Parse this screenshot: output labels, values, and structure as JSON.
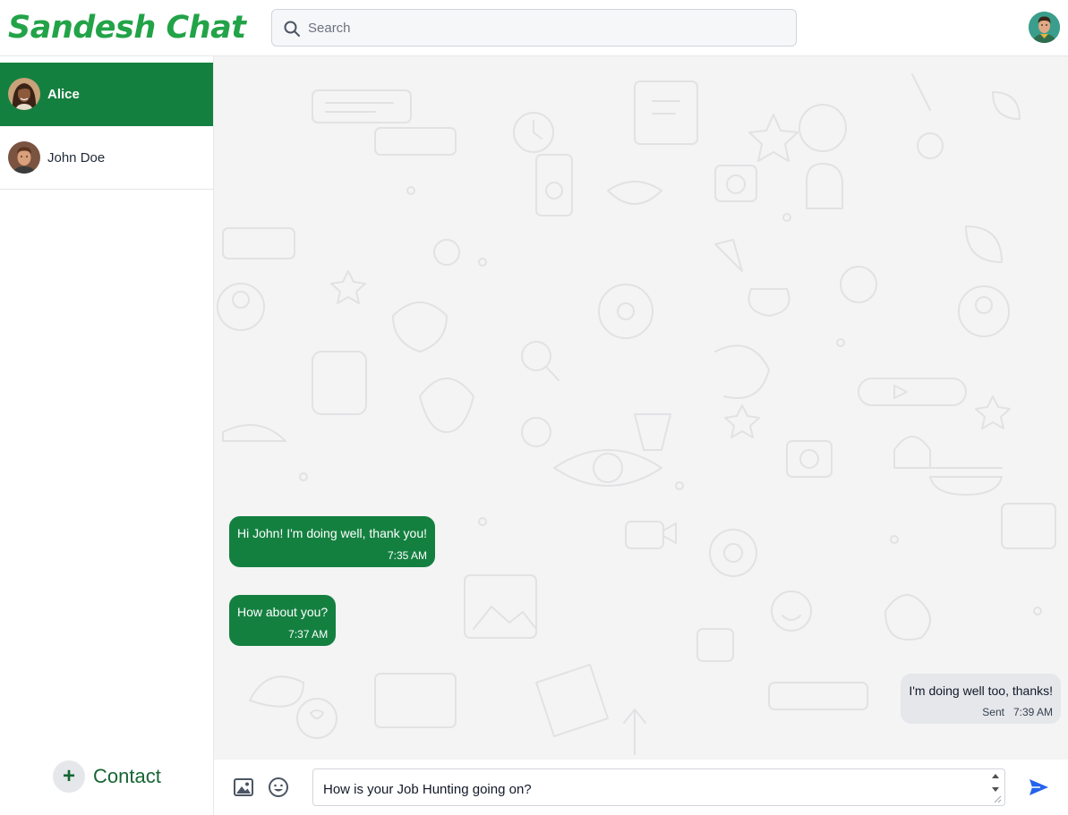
{
  "app": {
    "brand": "Sandesh Chat"
  },
  "search": {
    "placeholder": "Search",
    "icon": "search-icon"
  },
  "contacts": [
    {
      "name": "Alice",
      "active": true
    },
    {
      "name": "John Doe",
      "active": false
    }
  ],
  "sidebar": {
    "add_contact_icon": "+",
    "add_contact_label": "Contact"
  },
  "messages": [
    {
      "direction": "in",
      "text": "Hi John! I'm doing well, thank you!",
      "time": "7:35 AM"
    },
    {
      "direction": "in",
      "text": "How about you?",
      "time": "7:37 AM"
    },
    {
      "direction": "out",
      "text": "I'm doing well too, thanks!",
      "status": "Sent",
      "time": "7:39 AM"
    }
  ],
  "composer": {
    "value": "How is your Job Hunting going on?",
    "image_icon": "image-icon",
    "emoji_icon": "emoji-icon",
    "send_icon": "send-icon"
  },
  "colors": {
    "brand": "#22a348",
    "accent": "#148040",
    "outgoing_bubble": "#e5e7eb",
    "send": "#2563eb"
  }
}
